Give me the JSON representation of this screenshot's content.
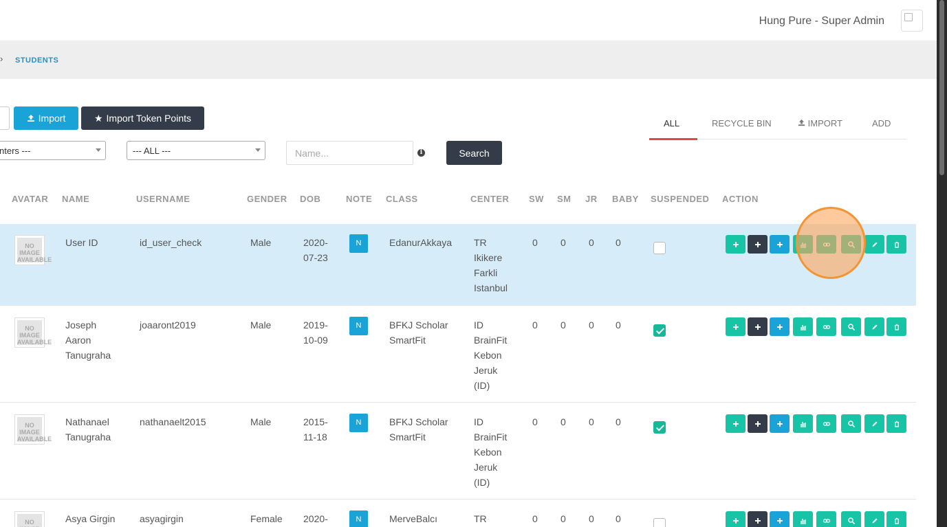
{
  "header": {
    "user_label": "Hung Pure - Super Admin"
  },
  "breadcrumb": {
    "current": "STUDENTS"
  },
  "toolbar": {
    "import_label": "Import",
    "import_token_label": "Import Token Points"
  },
  "tabs": [
    {
      "label": "ALL",
      "active": true
    },
    {
      "label": "RECYCLE BIN",
      "active": false
    },
    {
      "label": "IMPORT",
      "active": false
    },
    {
      "label": "ADD",
      "active": false
    }
  ],
  "filters": {
    "center_select": "nters ---",
    "class_select": "--- ALL ---",
    "name_placeholder": "Name...",
    "search_label": "Search"
  },
  "table": {
    "columns": [
      "AVATAR",
      "NAME",
      "USERNAME",
      "GENDER",
      "DOB",
      "NOTE",
      "CLASS",
      "CENTER",
      "SW",
      "SM",
      "JR",
      "BABY",
      "SUSPENDED",
      "ACTION"
    ],
    "avatar_placeholder": "NO IMAGE AVAILABLE",
    "rows": [
      {
        "name": [
          "User ID"
        ],
        "username": "id_user_check",
        "gender": "Male",
        "dob": [
          "2020-",
          "07-23"
        ],
        "note": "N",
        "class": [
          "EdanurAkkaya"
        ],
        "center": [
          "TR",
          "Ikikere",
          "Farkli",
          "Istanbul"
        ],
        "sw": "0",
        "sm": "0",
        "jr": "0",
        "baby": "0",
        "suspended": false,
        "highlighted": true
      },
      {
        "name": [
          "Joseph",
          "Aaron",
          "Tanugraha"
        ],
        "username": "joaaront2019",
        "gender": "Male",
        "dob": [
          "2019-",
          "10-09"
        ],
        "note": "N",
        "class": [
          "BFKJ Scholar",
          "SmartFit"
        ],
        "center": [
          "ID",
          "BrainFit",
          "Kebon",
          "Jeruk",
          "(ID)"
        ],
        "sw": "0",
        "sm": "0",
        "jr": "0",
        "baby": "0",
        "suspended": true,
        "highlighted": false
      },
      {
        "name": [
          "Nathanael",
          "Tanugraha"
        ],
        "username": "nathanaelt2015",
        "gender": "Male",
        "dob": [
          "2015-",
          "11-18"
        ],
        "note": "N",
        "class": [
          "BFKJ Scholar",
          "SmartFit"
        ],
        "center": [
          "ID",
          "BrainFit",
          "Kebon",
          "Jeruk",
          "(ID)"
        ],
        "sw": "0",
        "sm": "0",
        "jr": "0",
        "baby": "0",
        "suspended": true,
        "highlighted": false
      },
      {
        "name": [
          "Asya Girgin"
        ],
        "username": "asyagirgin",
        "gender": "Female",
        "dob": [
          "2020-"
        ],
        "note": "N",
        "class": [
          "MerveBalcı"
        ],
        "center": [
          "TR"
        ],
        "sw": "0",
        "sm": "0",
        "jr": "0",
        "baby": "0",
        "suspended": false,
        "highlighted": false
      }
    ],
    "actions": [
      {
        "icon": "plus-icon",
        "color": "teal"
      },
      {
        "icon": "plus-icon",
        "color": "dark"
      },
      {
        "icon": "plus-icon",
        "color": "blue"
      },
      {
        "icon": "bar-chart-icon",
        "color": "teal"
      },
      {
        "icon": "link-icon",
        "color": "teal"
      },
      {
        "icon": "search-icon",
        "color": "teal"
      },
      {
        "icon": "pencil-icon",
        "color": "teal"
      },
      {
        "icon": "trash-icon",
        "color": "teal"
      }
    ]
  },
  "colors": {
    "accent_blue": "#1aa3d6",
    "teal": "#17c4a6",
    "dark": "#333c48",
    "highlight_row": "#d6ecf8",
    "tab_active": "#e0474c",
    "click_marker": "#f49432"
  }
}
